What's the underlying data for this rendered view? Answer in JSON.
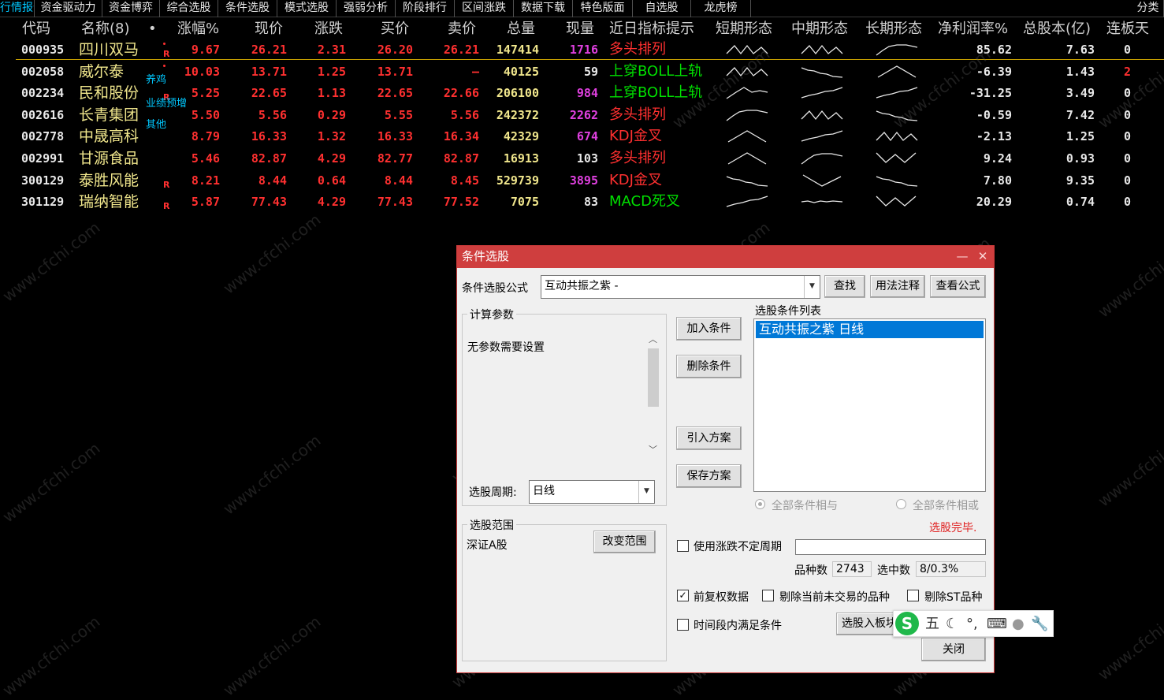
{
  "menu": [
    {
      "label": "行情报价",
      "active": true
    },
    {
      "label": "资金驱动力",
      "active": false
    },
    {
      "label": "资金博弈",
      "active": false
    },
    {
      "label": "综合选股",
      "active": false
    },
    {
      "label": "条件选股",
      "active": false
    },
    {
      "label": "模式选股",
      "active": false
    },
    {
      "label": "强弱分析",
      "active": false
    },
    {
      "label": "阶段排行",
      "active": false
    },
    {
      "label": "区间涨跌",
      "active": false
    },
    {
      "label": "数据下载",
      "active": false
    },
    {
      "label": "特色版面",
      "active": false
    },
    {
      "label": "自选股",
      "active": false
    },
    {
      "label": "龙虎榜",
      "active": false
    },
    {
      "label": "分类",
      "active": false
    }
  ],
  "columns": {
    "code": "代码",
    "name": "名称(8)",
    "dot": "•",
    "change_pct": "涨幅%",
    "price": "现价",
    "change": "涨跌",
    "bid": "买价",
    "ask": "卖价",
    "volume": "总量",
    "last_vol": "现量",
    "signal": "近日指标提示",
    "short": "短期形态",
    "mid": "中期形态",
    "long": "长期形态",
    "margin": "净利润率%",
    "shares": "总股本(亿)",
    "limit_days": "连板天"
  },
  "rows": [
    {
      "code": "000935",
      "name": "四川双马",
      "tag": "",
      "r": true,
      "dot": true,
      "change_pct": "9.67",
      "price": "26.21",
      "change": "2.31",
      "bid": "26.20",
      "ask": "26.21",
      "volume": "147414",
      "last_vol": "1716",
      "last_vol_color": "#e040e0",
      "signal": "多头排列",
      "signal_color": "#ff3030",
      "short": "m-shape",
      "mid": "m-shape",
      "long": "rise-plateau",
      "margin": "85.62",
      "shares": "7.63",
      "limit_days": "0",
      "limit_color": "#e8e8e8"
    },
    {
      "code": "002058",
      "name": "威尔泰",
      "tag": "",
      "r": false,
      "dot": true,
      "change_pct": "10.03",
      "price": "13.71",
      "change": "1.25",
      "bid": "13.71",
      "ask": "—",
      "volume": "40125",
      "last_vol": "59",
      "last_vol_color": "#e8e8e8",
      "signal": "上穿BOLL上轨",
      "signal_color": "#00e000",
      "short": "m-shape",
      "mid": "decline",
      "long": "peak",
      "margin": "-6.39",
      "shares": "1.43",
      "limit_days": "2",
      "limit_color": "#ff3030"
    },
    {
      "code": "002234",
      "name": "民和股份",
      "tag": "养鸡",
      "r": true,
      "dot": false,
      "change_pct": "5.25",
      "price": "22.65",
      "change": "1.13",
      "bid": "22.65",
      "ask": "22.66",
      "volume": "206100",
      "last_vol": "984",
      "last_vol_color": "#e040e0",
      "signal": "上穿BOLL上轨",
      "signal_color": "#00e000",
      "short": "peak-right",
      "mid": "rise",
      "long": "rise",
      "margin": "-31.25",
      "shares": "3.49",
      "limit_days": "0",
      "limit_color": "#e8e8e8"
    },
    {
      "code": "002616",
      "name": "长青集团",
      "tag": "业绩预增",
      "r": false,
      "dot": false,
      "change_pct": "5.50",
      "price": "5.56",
      "change": "0.29",
      "bid": "5.55",
      "ask": "5.56",
      "volume": "242372",
      "last_vol": "2262",
      "last_vol_color": "#e040e0",
      "signal": "多头排列",
      "signal_color": "#ff3030",
      "short": "rise-plateau",
      "mid": "m-shape",
      "long": "decline",
      "margin": "-0.59",
      "shares": "7.42",
      "limit_days": "0",
      "limit_color": "#e8e8e8"
    },
    {
      "code": "002778",
      "name": "中晟高科",
      "tag": "其他",
      "r": false,
      "dot": false,
      "change_pct": "8.79",
      "price": "16.33",
      "change": "1.32",
      "bid": "16.33",
      "ask": "16.34",
      "volume": "42329",
      "last_vol": "674",
      "last_vol_color": "#e040e0",
      "signal": "KDJ金叉",
      "signal_color": "#ff3030",
      "short": "peak",
      "mid": "rise",
      "long": "m-shape",
      "margin": "-2.13",
      "shares": "1.25",
      "limit_days": "0",
      "limit_color": "#e8e8e8"
    },
    {
      "code": "002991",
      "name": "甘源食品",
      "tag": "",
      "r": false,
      "dot": false,
      "change_pct": "5.46",
      "price": "82.87",
      "change": "4.29",
      "bid": "82.77",
      "ask": "82.87",
      "volume": "16913",
      "last_vol": "103",
      "last_vol_color": "#e8e8e8",
      "signal": "多头排列",
      "signal_color": "#ff3030",
      "short": "peak",
      "mid": "rise-plateau",
      "long": "w-shape",
      "margin": "9.24",
      "shares": "0.93",
      "limit_days": "0",
      "limit_color": "#e8e8e8"
    },
    {
      "code": "300129",
      "name": "泰胜风能",
      "tag": "",
      "r": true,
      "dot": false,
      "change_pct": "8.21",
      "price": "8.44",
      "change": "0.64",
      "bid": "8.44",
      "ask": "8.45",
      "volume": "529739",
      "last_vol": "3895",
      "last_vol_color": "#e040e0",
      "signal": "KDJ金叉",
      "signal_color": "#ff3030",
      "short": "decline",
      "mid": "valley",
      "long": "decline",
      "margin": "7.80",
      "shares": "9.35",
      "limit_days": "0",
      "limit_color": "#e8e8e8"
    },
    {
      "code": "301129",
      "name": "瑞纳智能",
      "tag": "",
      "r": true,
      "dot": false,
      "change_pct": "5.87",
      "price": "77.43",
      "change": "4.29",
      "bid": "77.43",
      "ask": "77.52",
      "volume": "7075",
      "last_vol": "83",
      "last_vol_color": "#e8e8e8",
      "signal": "MACD死叉",
      "signal_color": "#00e000",
      "short": "rise",
      "mid": "flat",
      "long": "w-shape",
      "margin": "20.29",
      "shares": "0.74",
      "limit_days": "0",
      "limit_color": "#e8e8e8"
    }
  ],
  "r_label": "R",
  "watermark": "www.cfchi.com",
  "dialog": {
    "title": "条件选股",
    "formula_label": "条件选股公式",
    "formula_value": "互动共振之紫 -",
    "find_btn": "查找",
    "usage_btn": "用法注释",
    "view_formula_btn": "查看公式",
    "params_title": "计算参数",
    "params_text": "无参数需要设置",
    "period_label": "选股周期:",
    "period_value": "日线",
    "add_btn": "加入条件",
    "del_btn": "删除条件",
    "import_btn": "引入方案",
    "save_btn": "保存方案",
    "cond_list_title": "选股条件列表",
    "cond_item": "互动共振之紫  日线",
    "and_label": "全部条件相与",
    "or_label": "全部条件相或",
    "status": "选股完毕.",
    "range_title": "选股范围",
    "range_value": "深证A股",
    "change_range_btn": "改变范围",
    "use_range_label": "使用涨跌不定周期",
    "count_label": "品种数",
    "count_value": "2743",
    "selected_label": "选中数",
    "selected_value": "8/0.3%",
    "fq_label": "前复权数据",
    "fq_checked": true,
    "remove_untraded_label": "剔除当前未交易的品种",
    "remove_st_label": "剔除ST品种",
    "period_cond_label": "时间段内满足条件",
    "to_board_btn": "选股入板块",
    "close_btn": "关闭"
  },
  "ime": {
    "logo": "S",
    "mode": "五"
  }
}
